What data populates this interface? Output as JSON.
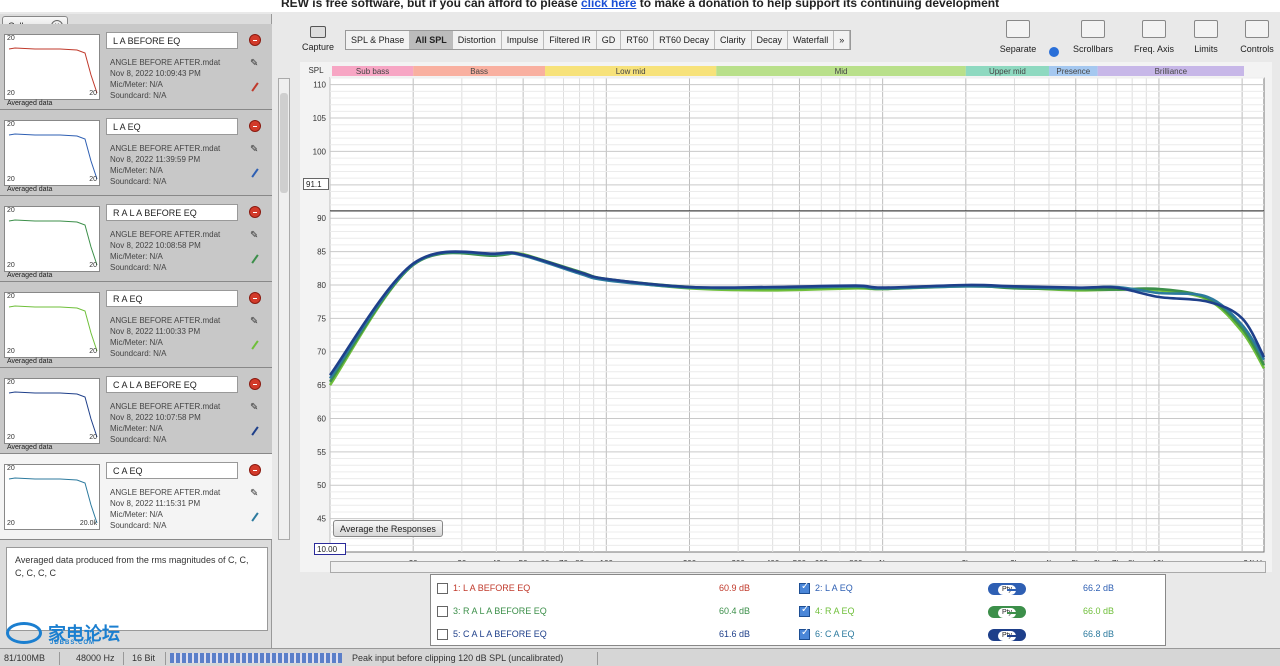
{
  "banner": {
    "text": "REW is free software, but if you can afford to please",
    "link": "click here",
    "text2": "to make a donation to help support its continuing development"
  },
  "left": {
    "collapse_label": "Collapse",
    "measurements": [
      {
        "name": "L A BEFORE EQ",
        "file": "ANGLE BEFORE AFTER.mdat",
        "date": "Nov 8, 2022 10:09:43 PM",
        "mic": "Mic/Meter: N/A",
        "sound": "Soundcard: N/A",
        "thumb_start": "20",
        "thumb_end": "20",
        "avg": "Averaged data",
        "color": "#c0392b"
      },
      {
        "name": "L A EQ",
        "file": "ANGLE BEFORE AFTER.mdat",
        "date": "Nov 8, 2022 11:39:59 PM",
        "mic": "Mic/Meter: N/A",
        "sound": "Soundcard: N/A",
        "thumb_start": "20",
        "thumb_end": "20",
        "avg": "Averaged data",
        "color": "#2e5fb3"
      },
      {
        "name": "R A L A BEFORE EQ",
        "file": "ANGLE BEFORE AFTER.mdat",
        "date": "Nov 8, 2022 10:08:58 PM",
        "mic": "Mic/Meter: N/A",
        "sound": "Soundcard: N/A",
        "thumb_start": "20",
        "thumb_end": "20",
        "avg": "Averaged data",
        "color": "#3c8f4a"
      },
      {
        "name": "R A EQ",
        "file": "ANGLE BEFORE AFTER.mdat",
        "date": "Nov 8, 2022 11:00:33 PM",
        "mic": "Mic/Meter: N/A",
        "sound": "Soundcard: N/A",
        "thumb_start": "20",
        "thumb_end": "20",
        "avg": "Averaged data",
        "color": "#6fbf3a"
      },
      {
        "name": "C A L A BEFORE EQ",
        "file": "ANGLE BEFORE AFTER.mdat",
        "date": "Nov 8, 2022 10:07:58 PM",
        "mic": "Mic/Meter: N/A",
        "sound": "Soundcard: N/A",
        "thumb_start": "20",
        "thumb_end": "20",
        "avg": "Averaged data",
        "color": "#1e3f8a"
      },
      {
        "name": "C A EQ",
        "file": "ANGLE BEFORE AFTER.mdat",
        "date": "Nov 8, 2022 11:15:31 PM",
        "mic": "Mic/Meter: N/A",
        "sound": "Soundcard: N/A",
        "thumb_start": "20",
        "thumb_end": "20.0k",
        "avg": "",
        "color": "#2c7a9e"
      }
    ],
    "notes": "Averaged data produced from the rms magnitudes of C, C, C, C, C, C"
  },
  "toolbar": {
    "capture": "Capture",
    "tabs": [
      "SPL & Phase",
      "All SPL",
      "Distortion",
      "Impulse",
      "Filtered IR",
      "GD",
      "RT60",
      "RT60 Decay",
      "Clarity",
      "Decay",
      "Waterfall",
      "»"
    ],
    "active_tab": 1,
    "right": [
      "Separate",
      "Scrollbars",
      "Freq. Axis",
      "Limits",
      "Controls"
    ]
  },
  "graph": {
    "y_unit": "SPL",
    "x_unit": "24kHz",
    "ref_value": "91.1",
    "x_start": "10.00",
    "avg_button": "Average the Responses",
    "bands": [
      {
        "label": "Sub bass",
        "color": "#f7a6c4"
      },
      {
        "label": "Bass",
        "color": "#f9b0a0"
      },
      {
        "label": "Low mid",
        "color": "#f7e27a"
      },
      {
        "label": "Mid",
        "color": "#b9e08a"
      },
      {
        "label": "Upper mid",
        "color": "#8ed9c0"
      },
      {
        "label": "Presence",
        "color": "#a5c8f0"
      },
      {
        "label": "Brilliance",
        "color": "#c7b7e8"
      }
    ]
  },
  "chart_data": {
    "type": "line",
    "xscale": "log",
    "xlim": [
      10,
      24000
    ],
    "ylim": [
      40,
      111
    ],
    "y_ticks": [
      45,
      50,
      55,
      60,
      65,
      70,
      75,
      80,
      85,
      90,
      95,
      100,
      105,
      110
    ],
    "x_ticks": [
      "20",
      "30",
      "40",
      "50",
      "60",
      "70",
      "80",
      "100",
      "200",
      "300",
      "400",
      "500",
      "600",
      "800",
      "1k",
      "2k",
      "3k",
      "4k",
      "5k",
      "6k",
      "7k",
      "8k",
      "10k"
    ],
    "reference_line": 91.1,
    "grid": true,
    "series": [
      {
        "color": "#6fbf3a",
        "x": [
          10,
          20,
          40,
          50,
          80,
          100,
          200,
          400,
          800,
          1000,
          2000,
          3000,
          5000,
          7000,
          10000,
          15000,
          20000,
          24000
        ],
        "y": [
          65,
          83,
          84.5,
          84.6,
          81.8,
          80.8,
          79.5,
          79.2,
          79.5,
          79.4,
          79.8,
          79.6,
          79.2,
          79.3,
          79.2,
          77.8,
          73,
          67.5
        ]
      },
      {
        "color": "#3c8f4a",
        "x": [
          10,
          20,
          40,
          50,
          80,
          100,
          200,
          400,
          800,
          1000,
          2000,
          3000,
          5000,
          7000,
          10000,
          15000,
          20000,
          24000
        ],
        "y": [
          65.5,
          83,
          84.4,
          84.5,
          82,
          80.9,
          79.7,
          79.5,
          79.7,
          79.4,
          79.9,
          79.5,
          79.4,
          79.3,
          79.4,
          78,
          73.5,
          68
        ]
      },
      {
        "color": "#2c7a9e",
        "x": [
          10,
          20,
          40,
          50,
          80,
          100,
          200,
          400,
          800,
          1000,
          2000,
          3000,
          5000,
          7000,
          10000,
          15000,
          20000,
          24000
        ],
        "y": [
          66,
          83.1,
          84.6,
          84.4,
          81.7,
          80.7,
          79.6,
          79.6,
          79.8,
          79.5,
          79.8,
          79.7,
          79.5,
          79.7,
          78.8,
          78.2,
          74,
          68.8
        ]
      },
      {
        "color": "#1e3f8a",
        "x": [
          10,
          20,
          40,
          50,
          80,
          100,
          200,
          400,
          800,
          1000,
          2000,
          3000,
          5000,
          7000,
          10000,
          15000,
          20000,
          24000
        ],
        "y": [
          66.5,
          83.2,
          84.7,
          84.5,
          81.9,
          80.9,
          79.7,
          79.7,
          79.9,
          79.6,
          80,
          79.8,
          79.6,
          79.6,
          78.2,
          77.5,
          75,
          69.2
        ]
      }
    ]
  },
  "legend": [
    {
      "left": {
        "label": "1: L A BEFORE EQ",
        "value": "60.9 dB",
        "checked": false,
        "color": "#c0392b"
      },
      "right": {
        "label": "2: L A EQ",
        "value": "66.2 dB",
        "checked": true,
        "color": "#2e5fb3"
      },
      "pill_color": "#2e5fb3",
      "pill": "Pty"
    },
    {
      "left": {
        "label": "3: R A L A BEFORE EQ",
        "value": "60.4 dB",
        "checked": false,
        "color": "#3c8f4a"
      },
      "right": {
        "label": "4: R A EQ",
        "value": "66.0 dB",
        "checked": true,
        "color": "#6fbf3a"
      },
      "pill_color": "#3c8f4a",
      "pill": "Pty"
    },
    {
      "left": {
        "label": "5: C A L A BEFORE EQ",
        "value": "61.6 dB",
        "checked": false,
        "color": "#1e3f8a"
      },
      "right": {
        "label": "6: C A EQ",
        "value": "66.8 dB",
        "checked": true,
        "color": "#2c7a9e"
      },
      "pill_color": "#1e3f8a",
      "pill": "Pty"
    }
  ],
  "status": {
    "mem": "81/100MB",
    "rate": "48000 Hz",
    "bits": "16 Bit",
    "peak": "Peak input before clipping 120 dB SPL (uncalibrated)"
  },
  "logo": {
    "text": "家电论坛",
    "sub": "JDBBS.COM"
  }
}
